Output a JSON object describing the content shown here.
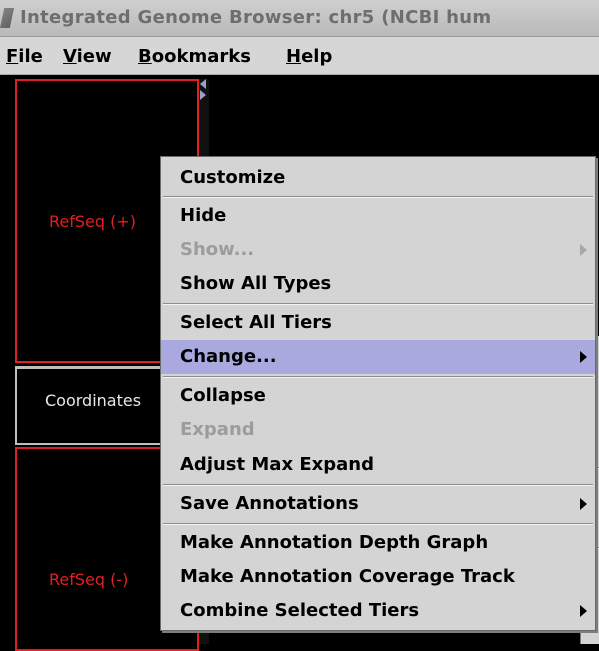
{
  "window": {
    "title": "Integrated Genome Browser:     chr5  (NCBI hum"
  },
  "menubar": [
    {
      "mnemonic": "F",
      "rest": "ile"
    },
    {
      "mnemonic": "V",
      "rest": "iew"
    },
    {
      "mnemonic": "B",
      "rest": "ookmarks"
    },
    {
      "mnemonic": "H",
      "rest": "elp"
    }
  ],
  "tiers": {
    "top_label": "RefSeq (+)",
    "coord_label": "Coordinates",
    "bottom_label": "RefSeq (-)"
  },
  "popup": {
    "items": [
      {
        "label": "Customize",
        "enabled": true,
        "submenu": false
      },
      {
        "label": "Hide",
        "enabled": true,
        "submenu": false
      },
      {
        "label": "Show...",
        "enabled": false,
        "submenu": true
      },
      {
        "label": "Show All Types",
        "enabled": true,
        "submenu": false
      },
      {
        "label": "Select All Tiers",
        "enabled": true,
        "submenu": false
      },
      {
        "label": "Change...",
        "enabled": true,
        "submenu": true,
        "selected": true
      },
      {
        "label": "Collapse",
        "enabled": true,
        "submenu": false
      },
      {
        "label": "Expand",
        "enabled": false,
        "submenu": false
      },
      {
        "label": "Adjust Max Expand",
        "enabled": true,
        "submenu": false
      },
      {
        "label": "Save Annotations",
        "enabled": true,
        "submenu": true
      },
      {
        "label": "Make Annotation Depth Graph",
        "enabled": true,
        "submenu": false
      },
      {
        "label": "Make Annotation Coverage Track",
        "enabled": true,
        "submenu": false
      },
      {
        "label": "Combine Selected Tiers",
        "enabled": true,
        "submenu": true
      }
    ]
  },
  "colors": {
    "tier_border": "#e02020",
    "menu_background": "#d4d4d4",
    "menu_selection": "#a9a9e0",
    "disabled_text": "#9c9c9c"
  }
}
